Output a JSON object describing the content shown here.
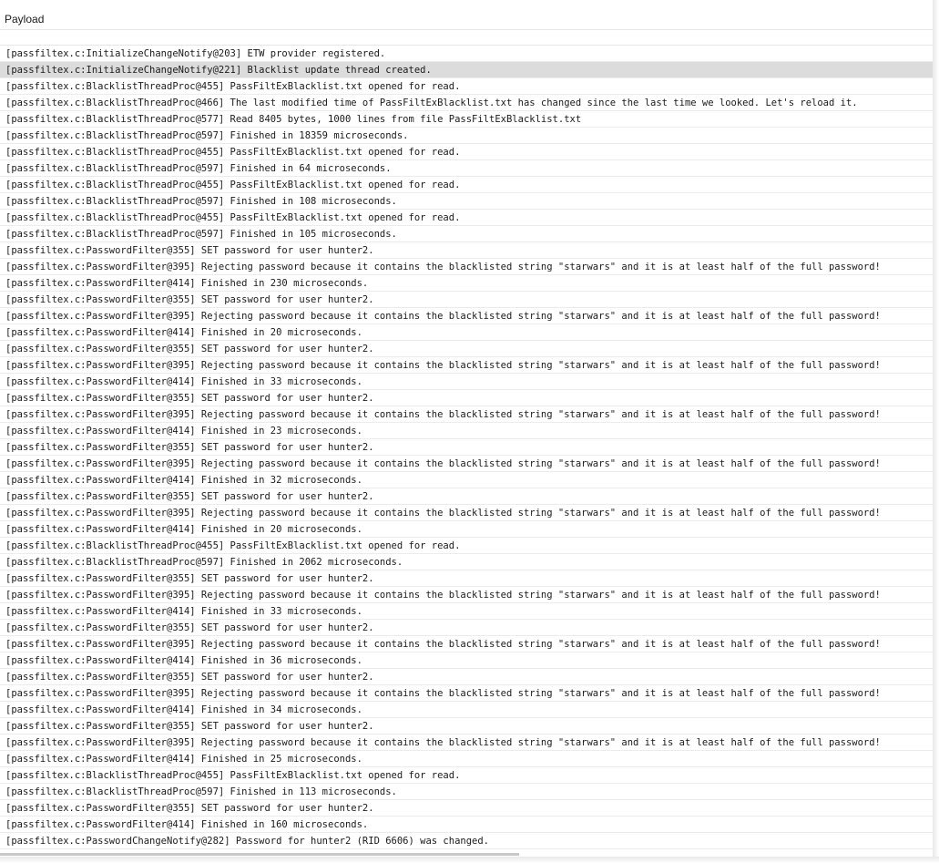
{
  "grid": {
    "column_header": "Payload",
    "selected_row": 1,
    "rows": [
      "[passfiltex.c:InitializeChangeNotify@203] ETW provider registered.",
      "[passfiltex.c:InitializeChangeNotify@221] Blacklist update thread created.",
      "[passfiltex.c:BlacklistThreadProc@455] PassFiltExBlacklist.txt opened for read.",
      "[passfiltex.c:BlacklistThreadProc@466] The last modified time of PassFiltExBlacklist.txt has changed since the last time we looked. Let's reload it.",
      "[passfiltex.c:BlacklistThreadProc@577] Read 8405 bytes, 1000 lines from file PassFiltExBlacklist.txt",
      "[passfiltex.c:BlacklistThreadProc@597] Finished in 18359 microseconds.",
      "[passfiltex.c:BlacklistThreadProc@455] PassFiltExBlacklist.txt opened for read.",
      "[passfiltex.c:BlacklistThreadProc@597] Finished in 64 microseconds.",
      "[passfiltex.c:BlacklistThreadProc@455] PassFiltExBlacklist.txt opened for read.",
      "[passfiltex.c:BlacklistThreadProc@597] Finished in 108 microseconds.",
      "[passfiltex.c:BlacklistThreadProc@455] PassFiltExBlacklist.txt opened for read.",
      "[passfiltex.c:BlacklistThreadProc@597] Finished in 105 microseconds.",
      "[passfiltex.c:PasswordFilter@355] SET password for user hunter2.",
      "[passfiltex.c:PasswordFilter@395] Rejecting password because it contains the blacklisted string \"starwars\" and it is at least half of the full password!",
      "[passfiltex.c:PasswordFilter@414] Finished in 230 microseconds.",
      "[passfiltex.c:PasswordFilter@355] SET password for user hunter2.",
      "[passfiltex.c:PasswordFilter@395] Rejecting password because it contains the blacklisted string \"starwars\" and it is at least half of the full password!",
      "[passfiltex.c:PasswordFilter@414] Finished in 20 microseconds.",
      "[passfiltex.c:PasswordFilter@355] SET password for user hunter2.",
      "[passfiltex.c:PasswordFilter@395] Rejecting password because it contains the blacklisted string \"starwars\" and it is at least half of the full password!",
      "[passfiltex.c:PasswordFilter@414] Finished in 33 microseconds.",
      "[passfiltex.c:PasswordFilter@355] SET password for user hunter2.",
      "[passfiltex.c:PasswordFilter@395] Rejecting password because it contains the blacklisted string \"starwars\" and it is at least half of the full password!",
      "[passfiltex.c:PasswordFilter@414] Finished in 23 microseconds.",
      "[passfiltex.c:PasswordFilter@355] SET password for user hunter2.",
      "[passfiltex.c:PasswordFilter@395] Rejecting password because it contains the blacklisted string \"starwars\" and it is at least half of the full password!",
      "[passfiltex.c:PasswordFilter@414] Finished in 32 microseconds.",
      "[passfiltex.c:PasswordFilter@355] SET password for user hunter2.",
      "[passfiltex.c:PasswordFilter@395] Rejecting password because it contains the blacklisted string \"starwars\" and it is at least half of the full password!",
      "[passfiltex.c:PasswordFilter@414] Finished in 20 microseconds.",
      "[passfiltex.c:BlacklistThreadProc@455] PassFiltExBlacklist.txt opened for read.",
      "[passfiltex.c:BlacklistThreadProc@597] Finished in 2062 microseconds.",
      "[passfiltex.c:PasswordFilter@355] SET password for user hunter2.",
      "[passfiltex.c:PasswordFilter@395] Rejecting password because it contains the blacklisted string \"starwars\" and it is at least half of the full password!",
      "[passfiltex.c:PasswordFilter@414] Finished in 33 microseconds.",
      "[passfiltex.c:PasswordFilter@355] SET password for user hunter2.",
      "[passfiltex.c:PasswordFilter@395] Rejecting password because it contains the blacklisted string \"starwars\" and it is at least half of the full password!",
      "[passfiltex.c:PasswordFilter@414] Finished in 36 microseconds.",
      "[passfiltex.c:PasswordFilter@355] SET password for user hunter2.",
      "[passfiltex.c:PasswordFilter@395] Rejecting password because it contains the blacklisted string \"starwars\" and it is at least half of the full password!",
      "[passfiltex.c:PasswordFilter@414] Finished in 34 microseconds.",
      "[passfiltex.c:PasswordFilter@355] SET password for user hunter2.",
      "[passfiltex.c:PasswordFilter@395] Rejecting password because it contains the blacklisted string \"starwars\" and it is at least half of the full password!",
      "[passfiltex.c:PasswordFilter@414] Finished in 25 microseconds.",
      "[passfiltex.c:BlacklistThreadProc@455] PassFiltExBlacklist.txt opened for read.",
      "[passfiltex.c:BlacklistThreadProc@597] Finished in 113 microseconds.",
      "[passfiltex.c:PasswordFilter@355] SET password for user hunter2.",
      "[passfiltex.c:PasswordFilter@414] Finished in 160 microseconds.",
      "[passfiltex.c:PasswordChangeNotify@282] Password for hunter2 (RID 6606) was changed."
    ]
  },
  "colors": {
    "selected_row_background": "#dcdcdc",
    "gridline": "#ececec",
    "text": "#1a1a1a"
  }
}
